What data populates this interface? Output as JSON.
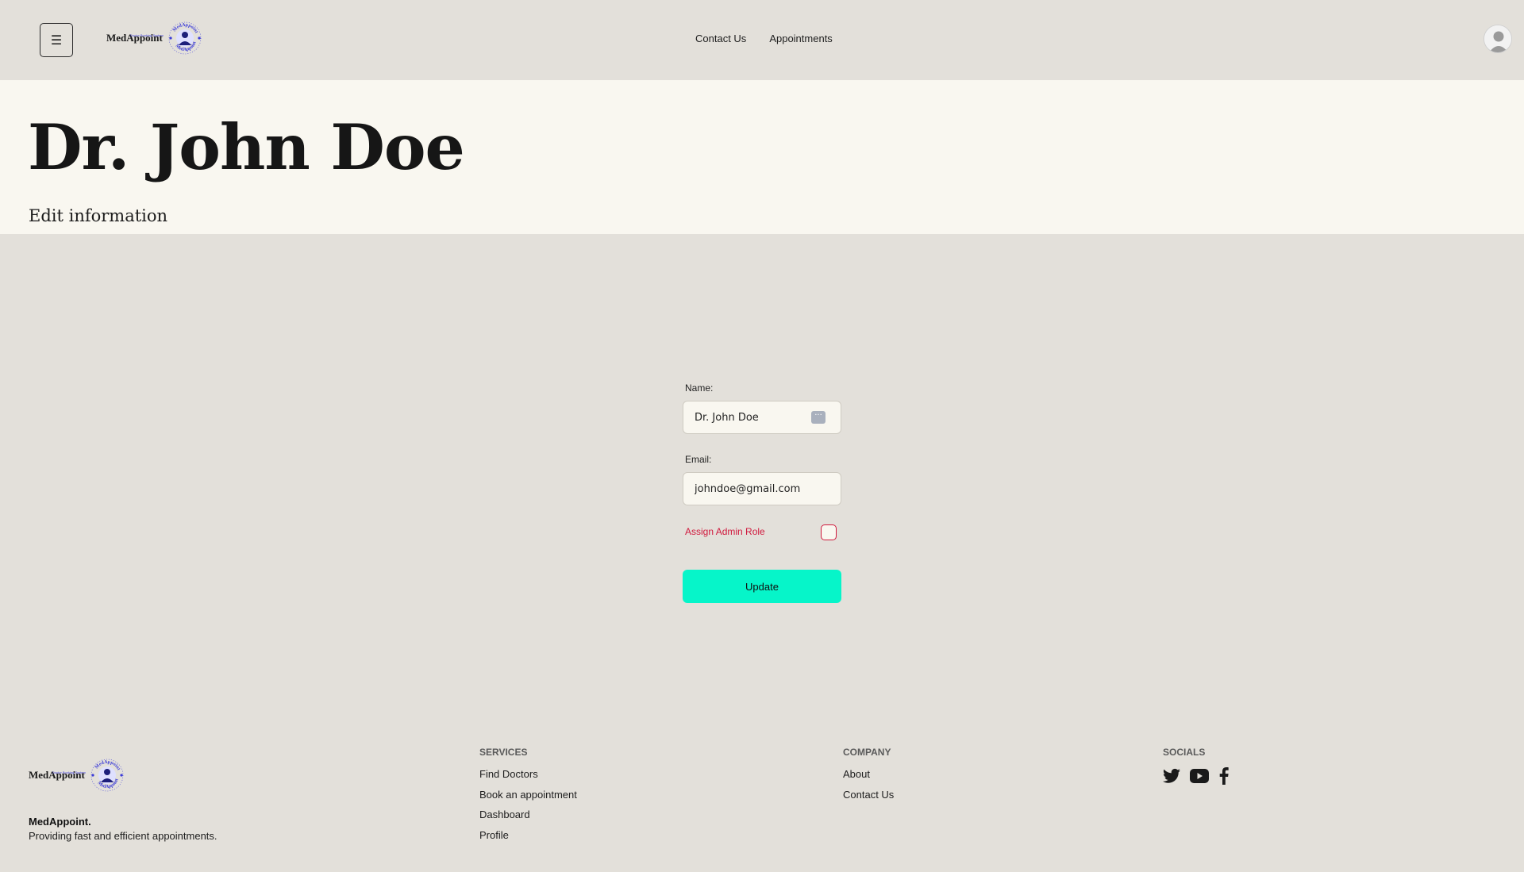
{
  "header": {
    "menu_icon": "☰",
    "logo_text": "MedAppoint",
    "logo_tagline": "Doctor Booking System",
    "logo_ring_text": "MedAppoint",
    "nav": [
      {
        "label": "Contact Us"
      },
      {
        "label": "Appointments"
      }
    ]
  },
  "hero": {
    "title": "Dr. John Doe",
    "subtitle": "Edit information"
  },
  "form": {
    "name_label": "Name:",
    "name_value": "Dr. John Doe",
    "name_icon": "password-manager-icon",
    "email_label": "Email:",
    "email_value": "johndoe@gmail.com",
    "admin_label": "Assign Admin Role",
    "admin_checked": false,
    "update_label": "Update"
  },
  "footer": {
    "logo_text": "MedAppoint",
    "logo_tagline": "Doctor Booking System",
    "brand_name": "MedAppoint.",
    "brand_desc": "Providing fast and efficient appointments.",
    "services": {
      "title": "SERVICES",
      "links": [
        {
          "label": "Find Doctors"
        },
        {
          "label": "Book an appointment"
        },
        {
          "label": "Dashboard"
        },
        {
          "label": "Profile"
        }
      ]
    },
    "company": {
      "title": "COMPANY",
      "links": [
        {
          "label": "About"
        },
        {
          "label": "Contact Us"
        }
      ]
    },
    "socials": {
      "title": "SOCIALS",
      "icons": [
        "twitter-icon",
        "youtube-icon",
        "facebook-icon"
      ]
    }
  },
  "colors": {
    "page_bg": "#e3e0da",
    "hero_bg": "#f9f7f0",
    "accent_button": "#06f5c9",
    "admin_red": "#d0193d",
    "logo_blue": "#3b3bd8"
  }
}
